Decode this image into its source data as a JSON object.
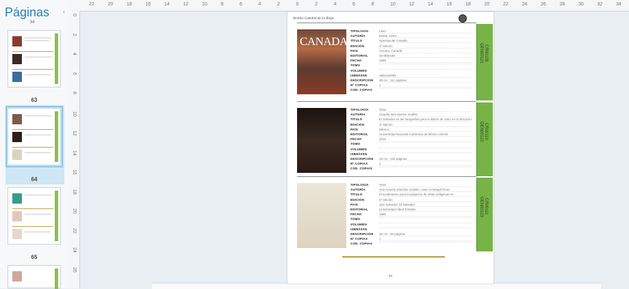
{
  "thumbnails_pane": {
    "title": "Páginas",
    "top_page_label": "94",
    "thumbs": [
      {
        "label": "63",
        "selected": false
      },
      {
        "label": "64",
        "selected": true
      },
      {
        "label": "65",
        "selected": false
      }
    ]
  },
  "ruler": {
    "h_numbers": [
      "22",
      "20",
      "18",
      "16",
      "14",
      "12",
      "10",
      "8",
      "6",
      "4",
      "2",
      "0",
      "2",
      "4",
      "6",
      "8",
      "10",
      "12",
      "14",
      "16",
      "18",
      "20",
      "22",
      "24",
      "26",
      "28",
      "30",
      "32",
      "34"
    ],
    "v_numbers": [
      "0",
      "2",
      "4",
      "6",
      "8",
      "10",
      "12",
      "14",
      "16",
      "18",
      "20",
      "22",
      "24",
      "26"
    ]
  },
  "page": {
    "header_title": "Archivo Catedral de La Rioja",
    "page_number": "64",
    "field_labels": [
      "TIPOLOGÍA",
      "AUTORÍA",
      "TÍTULO",
      "EDICIÓN",
      "PAÍS",
      "EDITORIAL",
      "FECHA",
      "TOMO",
      "VOLUMEN",
      "ISBN/ISSN",
      "DESCRIPCIÓN",
      "Nº COPIAS",
      "COD. COPIAS"
    ],
    "entries": [
      {
        "cover_text": "CANADA",
        "values": [
          "Libro",
          "Elaine Jones",
          "Spectacular Canada",
          "1ª edición",
          "Toronto, Canadá",
          "Smithbooks",
          "1985",
          "",
          "",
          "1551100305",
          "38 cm ; 111 páginas",
          "1",
          ""
        ],
        "side_code_1": "CR00109",
        "side_code_2": "OEN00121"
      },
      {
        "cover_text": "",
        "values": [
          "Tesis",
          "Claudia Inés Denzer Guillén",
          "El Salvador en las fotografías para el álbum de 1921 en la Sección Historia Cd",
          "1ª edición",
          "México",
          "Universidad Nacional Autónoma de México UNAM",
          "2010",
          "",
          "",
          "",
          "25 cm ; 154 páginas",
          "1",
          ""
        ],
        "side_code_1": "CR00110",
        "side_code_2": "OEN00122"
      },
      {
        "cover_text": "",
        "values": [
          "Tesis",
          "Ana Aracely Sánchez Castillo, José Armengol Rosa",
          "Procedimiento para la adopción de niñas indígenas en",
          "1ª edición",
          "San Salvador, El Salvador",
          "Universidad Albert Einstein",
          "1992",
          "",
          "",
          "",
          "26 cm ; 90 páginas",
          "1",
          ""
        ],
        "side_code_1": "CR00111",
        "side_code_2": "OEN00123"
      }
    ]
  },
  "colors": {
    "accent": "#2a7fb8",
    "sidebar_green": "#78b348",
    "gold": "#b99a3c"
  }
}
